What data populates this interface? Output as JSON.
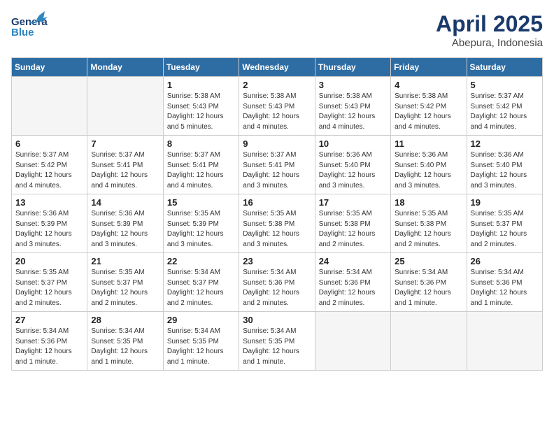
{
  "logo": {
    "line1": "General",
    "line2": "Blue"
  },
  "title": "April 2025",
  "subtitle": "Abepura, Indonesia",
  "days_of_week": [
    "Sunday",
    "Monday",
    "Tuesday",
    "Wednesday",
    "Thursday",
    "Friday",
    "Saturday"
  ],
  "weeks": [
    [
      {
        "num": "",
        "info": ""
      },
      {
        "num": "",
        "info": ""
      },
      {
        "num": "1",
        "info": "Sunrise: 5:38 AM\nSunset: 5:43 PM\nDaylight: 12 hours\nand 5 minutes."
      },
      {
        "num": "2",
        "info": "Sunrise: 5:38 AM\nSunset: 5:43 PM\nDaylight: 12 hours\nand 4 minutes."
      },
      {
        "num": "3",
        "info": "Sunrise: 5:38 AM\nSunset: 5:43 PM\nDaylight: 12 hours\nand 4 minutes."
      },
      {
        "num": "4",
        "info": "Sunrise: 5:38 AM\nSunset: 5:42 PM\nDaylight: 12 hours\nand 4 minutes."
      },
      {
        "num": "5",
        "info": "Sunrise: 5:37 AM\nSunset: 5:42 PM\nDaylight: 12 hours\nand 4 minutes."
      }
    ],
    [
      {
        "num": "6",
        "info": "Sunrise: 5:37 AM\nSunset: 5:42 PM\nDaylight: 12 hours\nand 4 minutes."
      },
      {
        "num": "7",
        "info": "Sunrise: 5:37 AM\nSunset: 5:41 PM\nDaylight: 12 hours\nand 4 minutes."
      },
      {
        "num": "8",
        "info": "Sunrise: 5:37 AM\nSunset: 5:41 PM\nDaylight: 12 hours\nand 4 minutes."
      },
      {
        "num": "9",
        "info": "Sunrise: 5:37 AM\nSunset: 5:41 PM\nDaylight: 12 hours\nand 3 minutes."
      },
      {
        "num": "10",
        "info": "Sunrise: 5:36 AM\nSunset: 5:40 PM\nDaylight: 12 hours\nand 3 minutes."
      },
      {
        "num": "11",
        "info": "Sunrise: 5:36 AM\nSunset: 5:40 PM\nDaylight: 12 hours\nand 3 minutes."
      },
      {
        "num": "12",
        "info": "Sunrise: 5:36 AM\nSunset: 5:40 PM\nDaylight: 12 hours\nand 3 minutes."
      }
    ],
    [
      {
        "num": "13",
        "info": "Sunrise: 5:36 AM\nSunset: 5:39 PM\nDaylight: 12 hours\nand 3 minutes."
      },
      {
        "num": "14",
        "info": "Sunrise: 5:36 AM\nSunset: 5:39 PM\nDaylight: 12 hours\nand 3 minutes."
      },
      {
        "num": "15",
        "info": "Sunrise: 5:35 AM\nSunset: 5:39 PM\nDaylight: 12 hours\nand 3 minutes."
      },
      {
        "num": "16",
        "info": "Sunrise: 5:35 AM\nSunset: 5:38 PM\nDaylight: 12 hours\nand 3 minutes."
      },
      {
        "num": "17",
        "info": "Sunrise: 5:35 AM\nSunset: 5:38 PM\nDaylight: 12 hours\nand 2 minutes."
      },
      {
        "num": "18",
        "info": "Sunrise: 5:35 AM\nSunset: 5:38 PM\nDaylight: 12 hours\nand 2 minutes."
      },
      {
        "num": "19",
        "info": "Sunrise: 5:35 AM\nSunset: 5:37 PM\nDaylight: 12 hours\nand 2 minutes."
      }
    ],
    [
      {
        "num": "20",
        "info": "Sunrise: 5:35 AM\nSunset: 5:37 PM\nDaylight: 12 hours\nand 2 minutes."
      },
      {
        "num": "21",
        "info": "Sunrise: 5:35 AM\nSunset: 5:37 PM\nDaylight: 12 hours\nand 2 minutes."
      },
      {
        "num": "22",
        "info": "Sunrise: 5:34 AM\nSunset: 5:37 PM\nDaylight: 12 hours\nand 2 minutes."
      },
      {
        "num": "23",
        "info": "Sunrise: 5:34 AM\nSunset: 5:36 PM\nDaylight: 12 hours\nand 2 minutes."
      },
      {
        "num": "24",
        "info": "Sunrise: 5:34 AM\nSunset: 5:36 PM\nDaylight: 12 hours\nand 2 minutes."
      },
      {
        "num": "25",
        "info": "Sunrise: 5:34 AM\nSunset: 5:36 PM\nDaylight: 12 hours\nand 1 minute."
      },
      {
        "num": "26",
        "info": "Sunrise: 5:34 AM\nSunset: 5:36 PM\nDaylight: 12 hours\nand 1 minute."
      }
    ],
    [
      {
        "num": "27",
        "info": "Sunrise: 5:34 AM\nSunset: 5:36 PM\nDaylight: 12 hours\nand 1 minute."
      },
      {
        "num": "28",
        "info": "Sunrise: 5:34 AM\nSunset: 5:35 PM\nDaylight: 12 hours\nand 1 minute."
      },
      {
        "num": "29",
        "info": "Sunrise: 5:34 AM\nSunset: 5:35 PM\nDaylight: 12 hours\nand 1 minute."
      },
      {
        "num": "30",
        "info": "Sunrise: 5:34 AM\nSunset: 5:35 PM\nDaylight: 12 hours\nand 1 minute."
      },
      {
        "num": "",
        "info": ""
      },
      {
        "num": "",
        "info": ""
      },
      {
        "num": "",
        "info": ""
      }
    ]
  ]
}
